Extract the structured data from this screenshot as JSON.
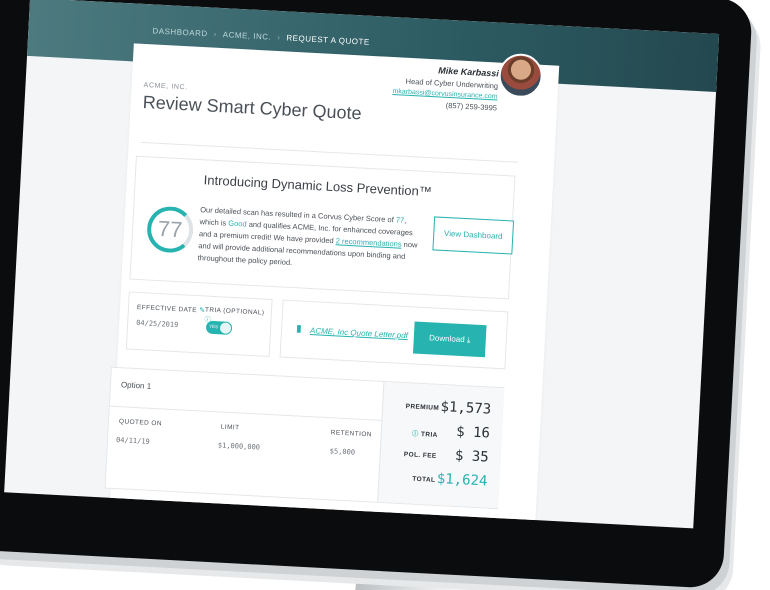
{
  "breadcrumb": {
    "items": [
      "Dashboard",
      "Acme, Inc.",
      "Request a Quote"
    ]
  },
  "header": {
    "company": "ACME, INC.",
    "title": "Review Smart Cyber Quote"
  },
  "rep": {
    "name": "Mike Karbassi",
    "title": "Head of Cyber Underwriting",
    "email": "mkarbassi@corvusinsurance.com",
    "phone": "(857) 259-3995"
  },
  "dlp": {
    "title": "Introducing Dynamic Loss Prevention™",
    "score": "77",
    "text_1": "Our detailed scan has resulted in a Corvus Cyber Score of ",
    "score_inline": "77",
    "text_2": ", which is ",
    "rating": "Good",
    "text_3": " and qualifies ACME, Inc. for enhanced coverages and a premium credit! We have provided ",
    "recommendations_link": "2 recommendations",
    "text_4": " now and will provide additional recommendations upon binding and throughout the policy period.",
    "view_button": "View Dashboard"
  },
  "effective": {
    "label": "EFFECTIVE DATE",
    "date": "04/25/2019",
    "tria_label": "TRIA (OPTIONAL)",
    "toggle_label": "YES"
  },
  "letter": {
    "filename": "ACME, Inc Quote Letter.pdf",
    "download_label": "Download"
  },
  "option": {
    "title": "Option 1",
    "columns": [
      {
        "header": "QUOTED ON",
        "value": "04/11/19"
      },
      {
        "header": "LIMIT",
        "value": "$1,000,000"
      },
      {
        "header": "RETENTION",
        "value": "$5,000"
      }
    ],
    "prices": [
      {
        "label": "PREMIUM",
        "value": "$1,573"
      },
      {
        "label": "TRIA",
        "value": "$  16"
      },
      {
        "label": "POL. FEE",
        "value": "$  35"
      },
      {
        "label": "TOTAL",
        "value": "$1,624"
      }
    ]
  },
  "colors": {
    "accent": "#27b3b0",
    "header_bar": "#2d5c63",
    "text": "#4a5057"
  }
}
